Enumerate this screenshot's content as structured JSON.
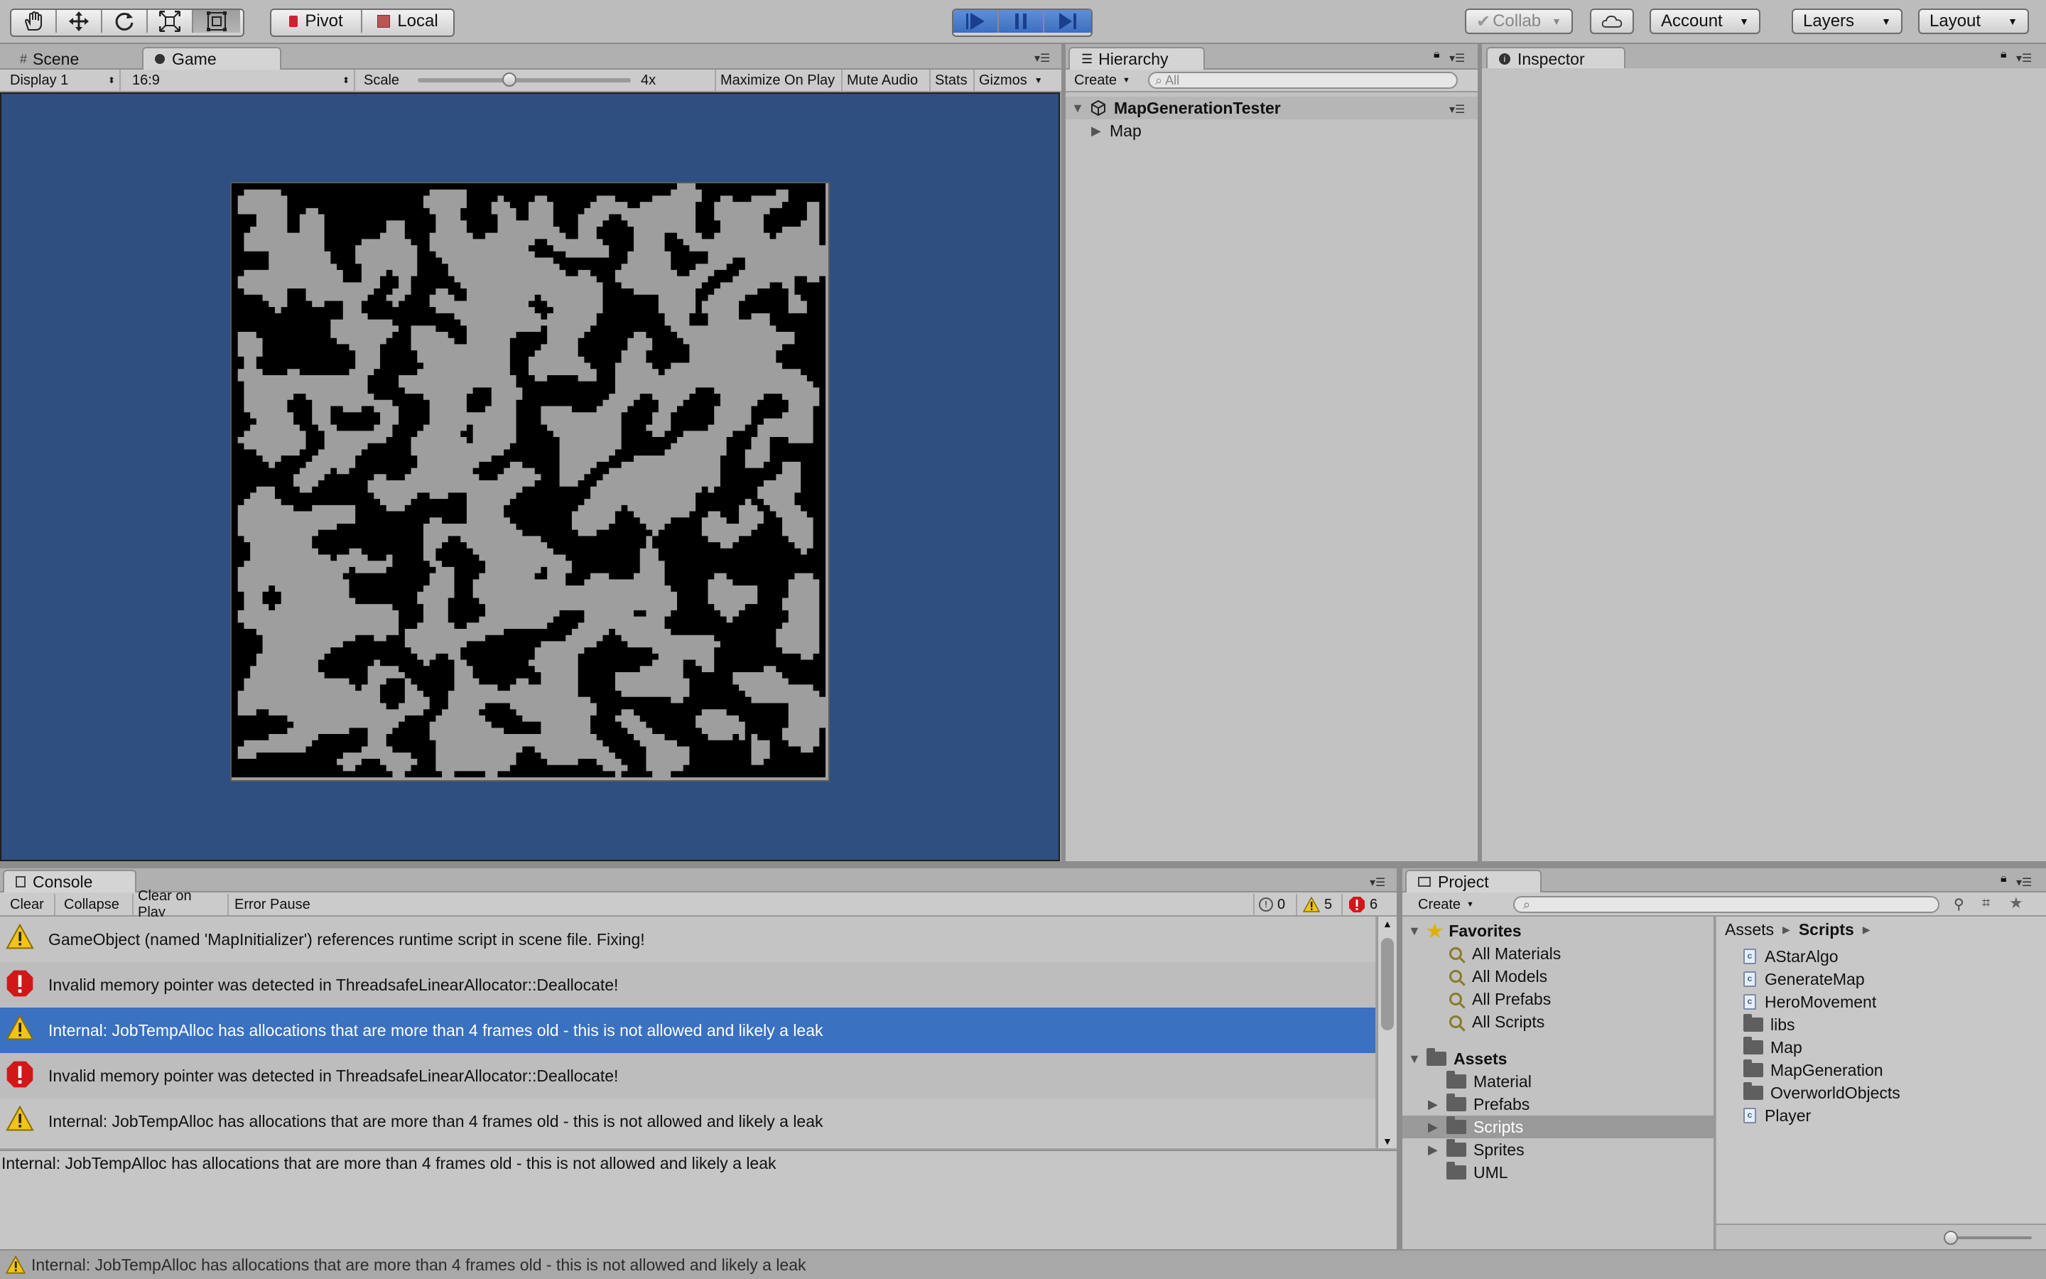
{
  "toolbar": {
    "tools": [
      "hand-tool",
      "move-tool",
      "rotate-tool",
      "scale-tool",
      "rect-tool"
    ],
    "pivot_label": "Pivot",
    "local_label": "Local",
    "collab_label": "Collab",
    "account_label": "Account",
    "layers_label": "Layers",
    "layout_label": "Layout"
  },
  "scene_tabs": {
    "scene": "Scene",
    "game": "Game"
  },
  "game_bar": {
    "display": "Display 1",
    "aspect": "16:9",
    "scale_label": "Scale",
    "scale_value": "4x",
    "scale_fraction": 0.43,
    "maximize": "Maximize On Play",
    "mute": "Mute Audio",
    "stats": "Stats",
    "gizmos": "Gizmos"
  },
  "hierarchy": {
    "tab": "Hierarchy",
    "create_label": "Create",
    "search_placeholder": "All",
    "scene_name": "MapGenerationTester",
    "children": [
      "Map"
    ]
  },
  "inspector": {
    "tab": "Inspector"
  },
  "console": {
    "tab": "Console",
    "buttons": {
      "clear": "Clear",
      "collapse": "Collapse",
      "clear_on_play": "Clear on Play",
      "error_pause": "Error Pause"
    },
    "counts": {
      "info": "0",
      "warning": "5",
      "error": "6"
    },
    "entries": [
      {
        "type": "warning",
        "text": "GameObject (named 'MapInitializer') references runtime script in scene file. Fixing!"
      },
      {
        "type": "error",
        "text": "Invalid memory pointer was detected in ThreadsafeLinearAllocator::Deallocate!"
      },
      {
        "type": "warning",
        "text": "Internal: JobTempAlloc has allocations that are more than 4 frames old - this is not allowed and likely a leak",
        "selected": true
      },
      {
        "type": "error",
        "text": "Invalid memory pointer was detected in ThreadsafeLinearAllocator::Deallocate!"
      },
      {
        "type": "warning",
        "text": "Internal: JobTempAlloc has allocations that are more than 4 frames old - this is not allowed and likely a leak"
      }
    ],
    "detail": "Internal: JobTempAlloc has allocations that are more than 4 frames old - this is not allowed and likely a leak"
  },
  "status_bar": {
    "text": "Internal: JobTempAlloc has allocations that are more than 4 frames old - this is not allowed and likely a leak"
  },
  "project": {
    "tab": "Project",
    "create_label": "Create",
    "favorites_label": "Favorites",
    "favorites": [
      "All Materials",
      "All Models",
      "All Prefabs",
      "All Scripts"
    ],
    "assets_label": "Assets",
    "asset_folders": [
      {
        "name": "Material",
        "expandable": false
      },
      {
        "name": "Prefabs",
        "expandable": true
      },
      {
        "name": "Scripts",
        "expandable": true,
        "selected": true
      },
      {
        "name": "Sprites",
        "expandable": true
      },
      {
        "name": "UML",
        "expandable": false
      }
    ],
    "breadcrumb": [
      "Assets",
      "Scripts"
    ],
    "files": [
      {
        "name": "AStarAlgo",
        "kind": "script"
      },
      {
        "name": "GenerateMap",
        "kind": "script"
      },
      {
        "name": "HeroMovement",
        "kind": "script"
      },
      {
        "name": "libs",
        "kind": "folder"
      },
      {
        "name": "Map",
        "kind": "folder"
      },
      {
        "name": "MapGeneration",
        "kind": "folder"
      },
      {
        "name": "OverworldObjects",
        "kind": "folder"
      },
      {
        "name": "Player",
        "kind": "script"
      }
    ]
  },
  "colors": {
    "game_background": "#2f4f80",
    "selection_blue": "#3a71c1",
    "warning_yellow": "#f0c419",
    "error_red": "#d01818"
  }
}
